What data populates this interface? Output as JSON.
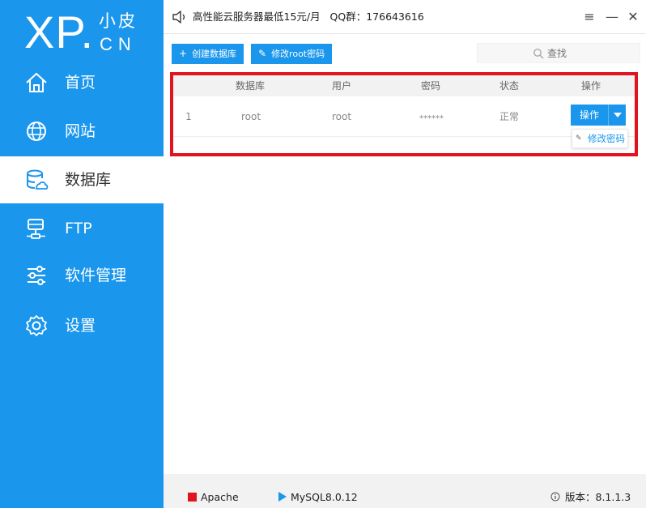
{
  "logo": {
    "main": "XP.",
    "top": "小皮",
    "bottom": "CN"
  },
  "sidebar": {
    "items": [
      {
        "label": "首页",
        "icon": "home-icon"
      },
      {
        "label": "网站",
        "icon": "globe-icon"
      },
      {
        "label": "数据库",
        "icon": "database-icon",
        "active": true
      },
      {
        "label": "FTP",
        "icon": "ftp-server-icon"
      },
      {
        "label": "软件管理",
        "icon": "sliders-icon"
      },
      {
        "label": "设置",
        "icon": "gear-icon"
      }
    ]
  },
  "topbar": {
    "notice": "高性能云服务器最低15元/月   QQ群：176643616",
    "menu_icon": "≡",
    "minimize_icon": "—",
    "close_icon": "✕"
  },
  "toolbar": {
    "create_db_label": "创建数据库",
    "change_root_pwd_label": "修改root密码",
    "search_placeholder": "查找"
  },
  "table": {
    "columns": [
      "数据库",
      "用户",
      "密码",
      "状态",
      "操作"
    ],
    "rows": [
      {
        "index": "1",
        "database": "root",
        "user": "root",
        "password": "******",
        "status": "正常",
        "action": "操作"
      }
    ]
  },
  "dropdown": {
    "item": "修改密码"
  },
  "statusbar": {
    "apache": "Apache",
    "mysql": "MySQL8.0.12",
    "version": "版本：8.1.1.3"
  },
  "colors": {
    "accent": "#1a96ec",
    "highlight_box": "#e0131e",
    "stopped": "#e0131e"
  }
}
